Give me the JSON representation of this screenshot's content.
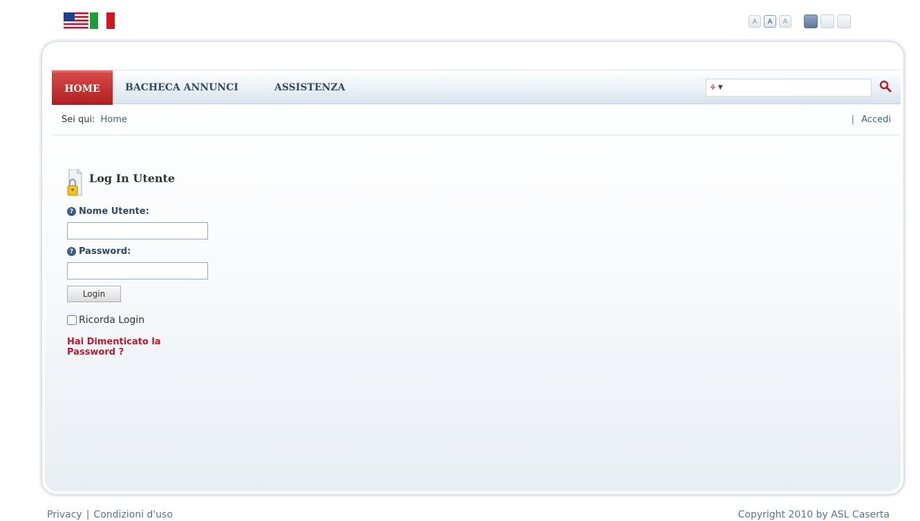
{
  "languages": [
    {
      "name": "english-flag-icon",
      "label": "English"
    },
    {
      "name": "italian-flag-icon",
      "label": "Italiano"
    }
  ],
  "tools": {
    "font_sizes": [
      "A",
      "A",
      "A"
    ],
    "layouts": [
      "wide",
      "medium",
      "narrow"
    ]
  },
  "nav": {
    "items": [
      {
        "label": "HOME",
        "active": true
      },
      {
        "label": "BACHECA ANNUNCI",
        "active": false
      },
      {
        "label": "ASSISTENZA",
        "active": false
      }
    ]
  },
  "search": {
    "value": "",
    "placeholder": ""
  },
  "breadcrumb": {
    "label": "Sei qui:",
    "current": "Home",
    "login_link": "Accedi",
    "separator": "|"
  },
  "login": {
    "title": "Log In Utente",
    "username_label": "Nome Utente:",
    "username_value": "",
    "password_label": "Password:",
    "password_value": "",
    "button_label": "Login",
    "remember_label": "Ricorda Login",
    "forgot_label": "Hai Dimenticato la Password ?"
  },
  "footer": {
    "privacy": "Privacy",
    "separator": "|",
    "terms": "Condizioni d'uso",
    "copyright": "Copyright 2010 by ASL Caserta"
  },
  "colors": {
    "accent_red": "#b11e1e",
    "link_blue": "#35638e",
    "nav_text": "#2e4a66"
  }
}
